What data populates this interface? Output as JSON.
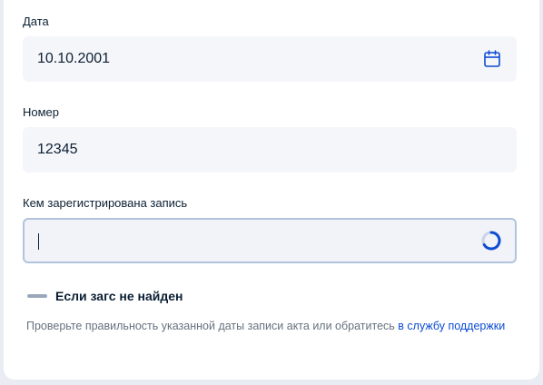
{
  "form": {
    "date_field": {
      "label": "Дата",
      "value": "10.10.2001",
      "icon": "calendar-icon"
    },
    "number_field": {
      "label": "Номер",
      "value": "12345"
    },
    "registry_field": {
      "label": "Кем зарегистрирована запись",
      "value": "",
      "icon": "loading-spinner-icon"
    }
  },
  "not_found": {
    "title": "Если загс не найден",
    "hint_text": "Проверьте правильность указанной даты записи акта или обратитесь ",
    "hint_link": "в службу поддержки"
  },
  "colors": {
    "accent": "#0d4cd3",
    "field_bg": "#f5f6fa",
    "active_border": "#b2c3de",
    "muted_text": "#66727f"
  }
}
